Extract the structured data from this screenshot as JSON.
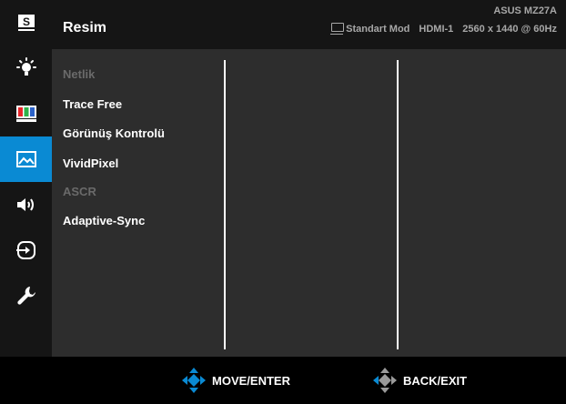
{
  "colors": {
    "accent": "#0a8ad3",
    "sidebar_bg": "#151515",
    "content_bg": "#2d2d2d",
    "text": "#ffffff",
    "disabled_text": "#6a6a6a",
    "header_info": "#a7a7a7"
  },
  "sidebar": {
    "items": [
      {
        "icon": "splendid-s-icon",
        "active": false
      },
      {
        "icon": "blue-light-filter-icon",
        "active": false
      },
      {
        "icon": "color-bars-icon",
        "active": false
      },
      {
        "icon": "image-icon",
        "active": true
      },
      {
        "icon": "speaker-icon",
        "active": false
      },
      {
        "icon": "input-select-icon",
        "active": false
      },
      {
        "icon": "wrench-icon",
        "active": false
      }
    ]
  },
  "header": {
    "title": "Resim",
    "model": "ASUS MZ27A",
    "mode": "Standart Mod",
    "input": "HDMI-1",
    "resolution": "2560 x 1440 @ 60Hz"
  },
  "menu": {
    "items": [
      {
        "label": "Netlik",
        "enabled": false
      },
      {
        "label": "Trace Free",
        "enabled": true
      },
      {
        "label": "Görünüş Kontrolü",
        "enabled": true
      },
      {
        "label": "VividPixel",
        "enabled": true
      },
      {
        "label": "ASCR",
        "enabled": false
      },
      {
        "label": "Adaptive-Sync",
        "enabled": true
      }
    ]
  },
  "footer": {
    "move_label": "MOVE/ENTER",
    "back_label": "BACK/EXIT"
  }
}
